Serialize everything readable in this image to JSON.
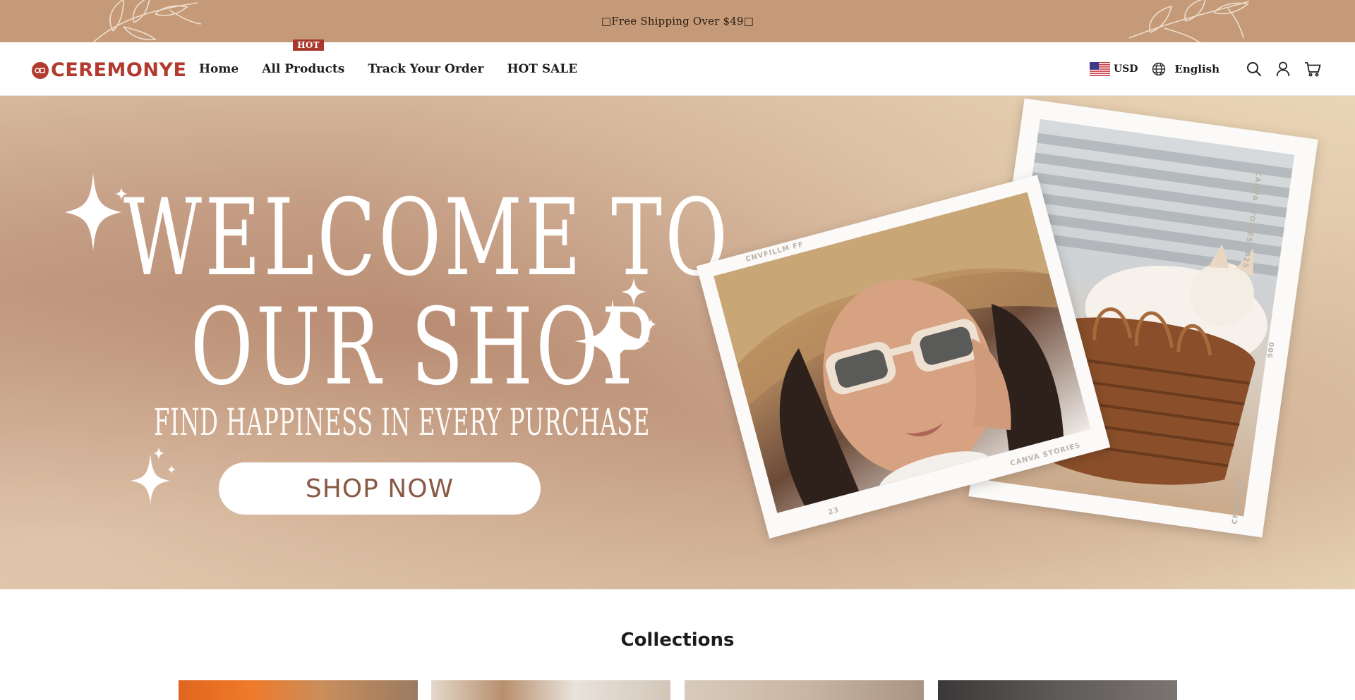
{
  "announcement": {
    "text": "□Free Shipping Over $49□"
  },
  "header": {
    "logo_text": "CEREMONYE",
    "nav": [
      {
        "label": "Home"
      },
      {
        "label": "All Products",
        "badge": "HOT"
      },
      {
        "label": "Track Your Order"
      },
      {
        "label": "HOT SALE"
      }
    ],
    "currency": "USD",
    "language": "English",
    "icons": [
      "us-flag-icon",
      "globe-icon",
      "search-icon",
      "account-icon",
      "cart-icon"
    ]
  },
  "hero": {
    "title_line1": "WELCOME TO",
    "title_line2": "OUR SHOP",
    "subtitle": "FIND HAPPINESS IN EVERY PURCHASE",
    "cta": "SHOP NOW",
    "photo_labels": {
      "girl_top": "CNVFILLM FF",
      "girl_bottom_left": "23",
      "girl_bottom_right": "CANVA STORIES",
      "cat_side_top": "CANVA STORIES 2025",
      "cat_side_mid": "006",
      "cat_side_bottom": "CNVFILLM"
    }
  },
  "collections": {
    "title": "Collections"
  },
  "colors": {
    "announce_bg": "#c59a78",
    "brand_red": "#b23a2e",
    "hot_badge": "#a8392c",
    "cta_text": "#8a5a47"
  }
}
